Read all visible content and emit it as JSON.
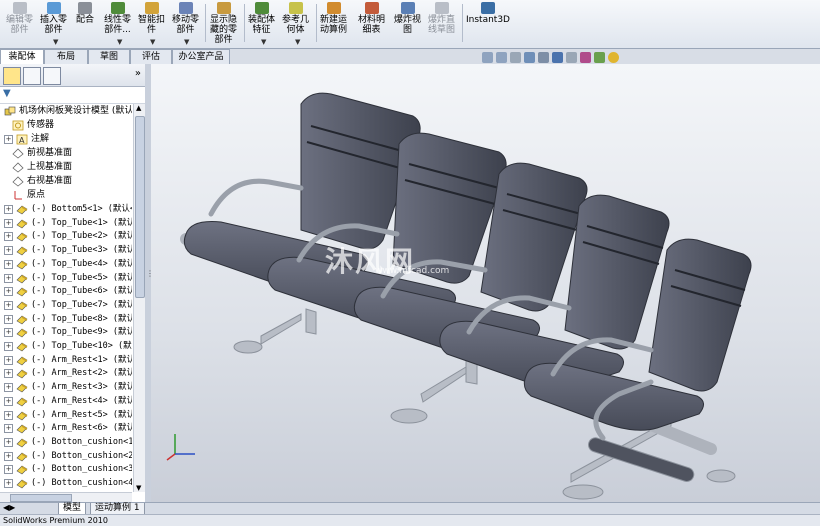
{
  "toolbar": {
    "buttons": [
      {
        "label": "编辑零\n部件",
        "disabled": true
      },
      {
        "label": "插入零\n部件"
      },
      {
        "label": "配合"
      },
      {
        "label": "线性零\n部件..."
      },
      {
        "label": "智能扣\n件"
      },
      {
        "label": "移动零\n部件"
      },
      {
        "label": "显示隐\n藏的零\n部件"
      },
      {
        "label": "装配体\n特征"
      },
      {
        "label": "参考几\n何体"
      },
      {
        "label": "新建运\n动算例"
      },
      {
        "label": "材料明\n细表"
      },
      {
        "label": "爆炸视\n图"
      },
      {
        "label": "爆炸直\n线草图",
        "disabled": true
      },
      {
        "label": "Instant3D"
      }
    ]
  },
  "tabs": [
    "装配体",
    "布局",
    "草图",
    "评估",
    "办公室产品"
  ],
  "tree": {
    "root": "机场休闲板凳设计模型 (默认",
    "items": [
      "传感器",
      "注解",
      "前视基准面",
      "上视基准面",
      "右视基准面",
      "原点",
      "(-) Bottom5<1> (默认<<",
      "(-) Top_Tube<1> (默认<",
      "(-) Top_Tube<2> (默认<",
      "(-) Top_Tube<3> (默认<",
      "(-) Top_Tube<4> (默认<",
      "(-) Top_Tube<5> (默认<",
      "(-) Top_Tube<6> (默认<",
      "(-) Top_Tube<7> (默认<",
      "(-) Top_Tube<8> (默认<",
      "(-) Top_Tube<9> (默认<",
      "(-) Top_Tube<10> (默认<",
      "(-) Arm_Rest<1> (默认<",
      "(-) Arm_Rest<2> (默认<",
      "(-) Arm_Rest<3> (默认<",
      "(-) Arm_Rest<4> (默认<",
      "(-) Arm_Rest<5> (默认<",
      "(-) Arm_Rest<6> (默认<",
      "(-) Botton_cushion<1>",
      "(-) Botton_cushion<2>",
      "(-) Botton_cushion<3>",
      "(-) Botton_cushion<4>"
    ]
  },
  "bottom_tabs": [
    "模型",
    "运动算例 1"
  ],
  "status": "SolidWorks Premium 2010",
  "watermark": {
    "main": "沐风网",
    "sub": "www.mfcad.com"
  },
  "colors": {
    "accent": "#3a6ea5",
    "chair": "#5b5f6e",
    "frame": "#b8bdc6"
  }
}
